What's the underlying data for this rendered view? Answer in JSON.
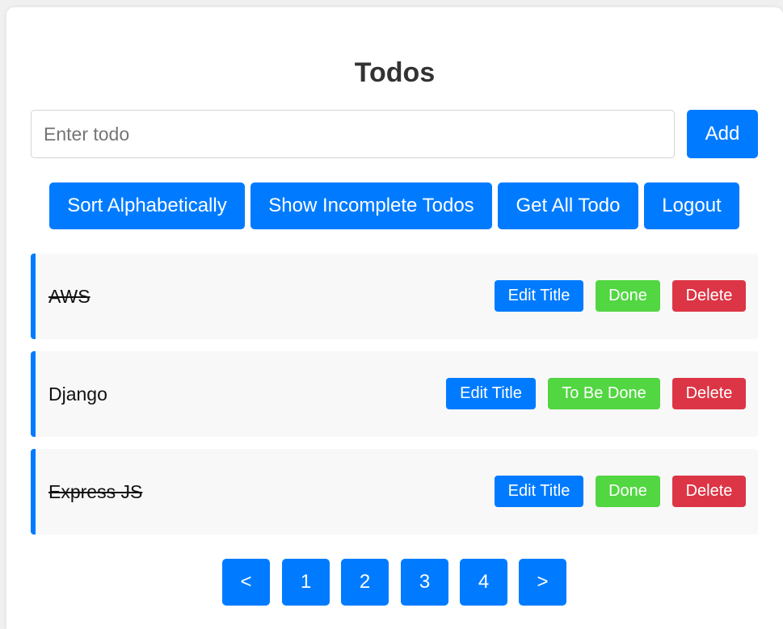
{
  "header": {
    "title": "Todos"
  },
  "new_todo": {
    "placeholder": "Enter todo",
    "value": "",
    "add_label": "Add"
  },
  "toolbar": {
    "sort_label": "Sort Alphabetically",
    "incomplete_label": "Show Incomplete Todos",
    "get_all_label": "Get All Todo",
    "logout_label": "Logout"
  },
  "todos": [
    {
      "title": "AWS",
      "completed": true,
      "edit_label": "Edit Title",
      "status_label": "Done",
      "delete_label": "Delete"
    },
    {
      "title": "Django",
      "completed": false,
      "edit_label": "Edit Title",
      "status_label": "To Be Done",
      "delete_label": "Delete"
    },
    {
      "title": "Express JS",
      "completed": true,
      "edit_label": "Edit Title",
      "status_label": "Done",
      "delete_label": "Delete"
    }
  ],
  "pagination": {
    "prev_label": "<",
    "pages": [
      "1",
      "2",
      "3",
      "4"
    ],
    "next_label": ">"
  },
  "colors": {
    "primary": "#007bff",
    "success": "#52d642",
    "danger": "#dc3545",
    "item_background": "#f8f8f8"
  }
}
